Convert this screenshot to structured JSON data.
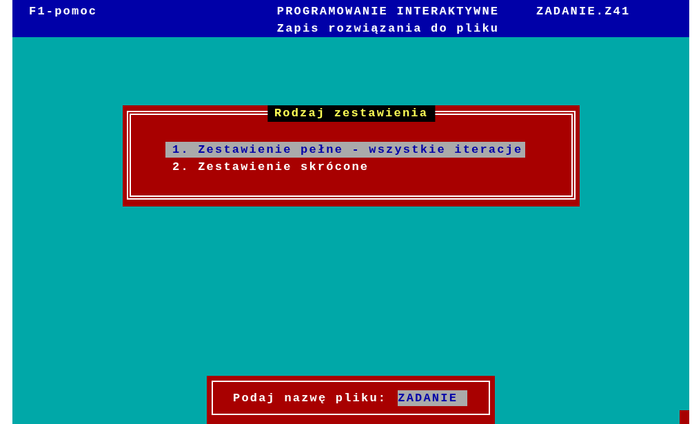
{
  "header": {
    "help_hint": "F1-pomoc",
    "title": "PROGRAMOWANIE INTERAKTYWNE",
    "subtitle": "Zapis rozwiązania do pliku",
    "file_name": "ZADANIE.Z41"
  },
  "menu_dialog": {
    "title": "Rodzaj zestawienia",
    "items": [
      {
        "label": "1. Zestawienie pełne - wszystkie iteracje",
        "selected": true
      },
      {
        "label": "2. Zestawienie skrócone",
        "selected": false
      }
    ]
  },
  "filename_dialog": {
    "label": "Podaj nazwę pliku:",
    "value": "ZADANIE"
  }
}
